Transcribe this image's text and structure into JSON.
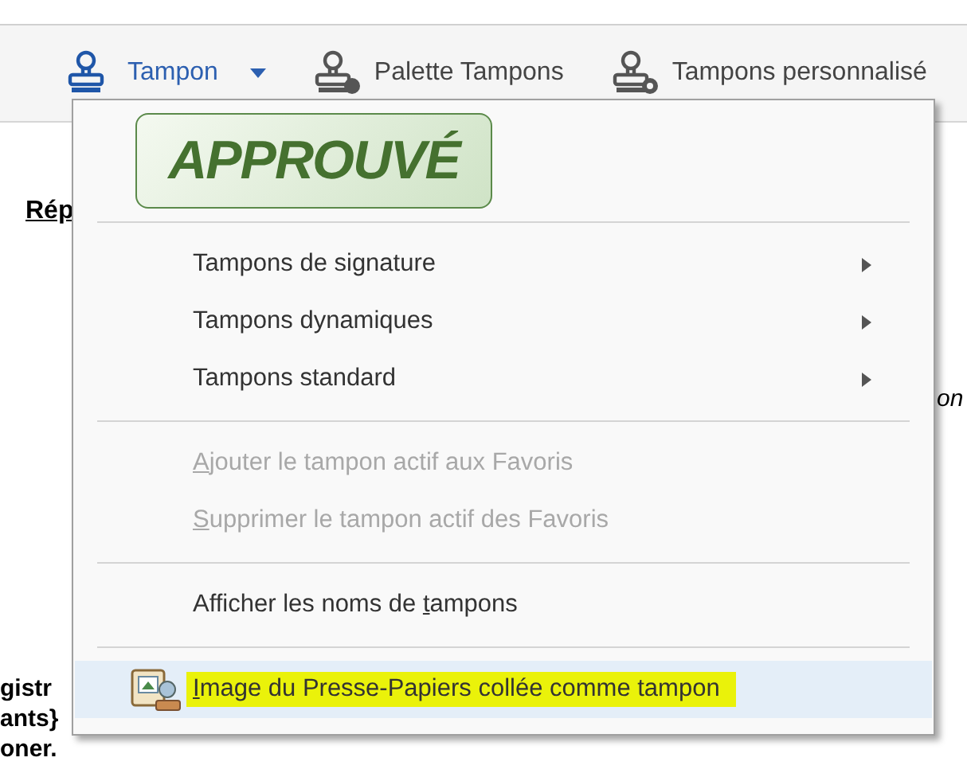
{
  "toolbar": {
    "items": [
      {
        "label": "Tampon",
        "selected": true,
        "dropdown": true
      },
      {
        "label": "Palette Tampons",
        "selected": false,
        "dropdown": false
      },
      {
        "label": "Tampons personnalisé",
        "selected": false,
        "dropdown": false
      }
    ]
  },
  "document": {
    "heading": "Rép",
    "fragments": [
      "on",
      "gistr",
      "ants}",
      "oner."
    ]
  },
  "menu": {
    "stamp_preview": "APPROUVÉ",
    "items": [
      {
        "kind": "separator"
      },
      {
        "kind": "submenu",
        "label": "Tampons de signature",
        "disabled": false
      },
      {
        "kind": "submenu",
        "label": "Tampons dynamiques",
        "disabled": false
      },
      {
        "kind": "submenu",
        "label": "Tampons standard",
        "disabled": false
      },
      {
        "kind": "separator"
      },
      {
        "kind": "command",
        "key": "A",
        "label": "jouter le tampon actif aux Favoris",
        "disabled": true
      },
      {
        "kind": "command",
        "key": "S",
        "label": "upprimer le tampon actif des Favoris",
        "disabled": true
      },
      {
        "kind": "separator"
      },
      {
        "kind": "command",
        "before": "Afficher les noms de ",
        "key": "t",
        "label": "ampons",
        "disabled": false
      },
      {
        "kind": "separator"
      },
      {
        "kind": "image",
        "key": "I",
        "label": "mage du Presse-Papiers collée comme tampon",
        "disabled": false,
        "selected": true,
        "highlighted": true
      }
    ]
  }
}
